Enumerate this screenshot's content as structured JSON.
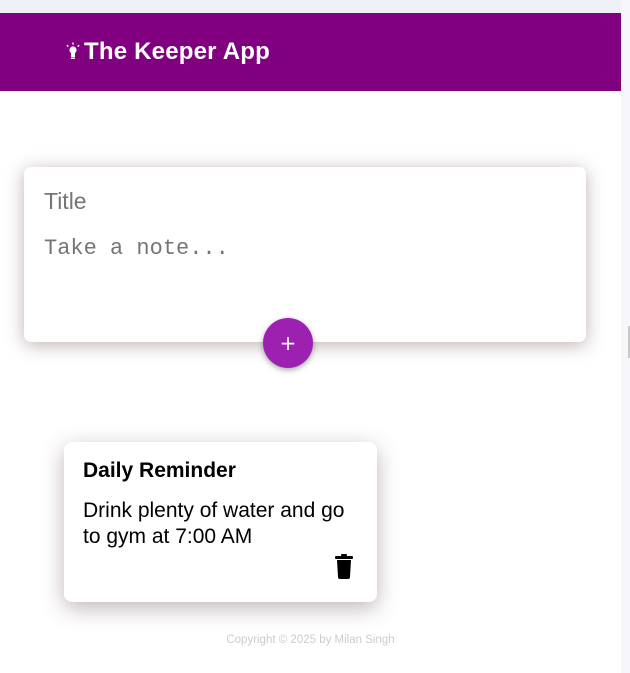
{
  "app": {
    "title": "The Keeper App",
    "logo_icon": "lightbulb-icon",
    "brand_color": "#800080"
  },
  "create_area": {
    "title_placeholder": "Title",
    "content_placeholder": "Take a note...",
    "add_button_label": "+",
    "add_button_color": "#9d21b1"
  },
  "notes": [
    {
      "title": "Daily Reminder",
      "content": "Drink plenty of water and go to gym at 7:00 AM",
      "delete_icon": "trash-icon"
    }
  ],
  "footer": {
    "text": "Copyright © 2025 by Milan Singh"
  }
}
